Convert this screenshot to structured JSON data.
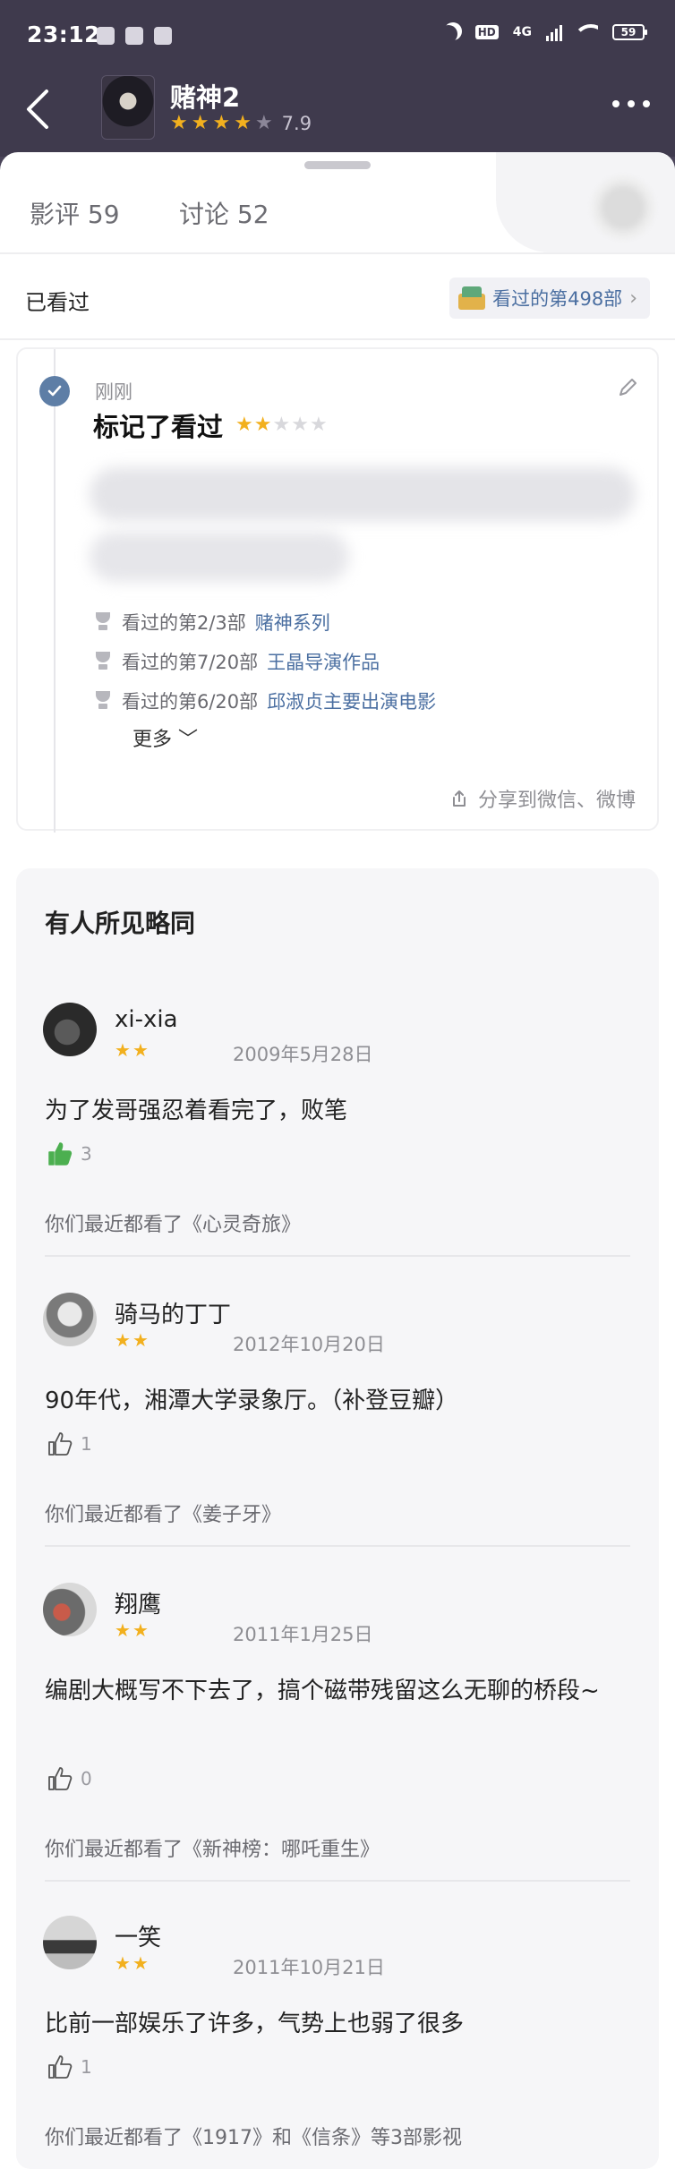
{
  "status_bar": {
    "time": "23:12",
    "network": "4G",
    "battery": "59"
  },
  "header": {
    "title": "赌神2",
    "rating": "7.9",
    "stars_filled": 4
  },
  "tabs": {
    "reviews": "影评 59",
    "discussions": "讨论 52"
  },
  "watched": {
    "label": "已看过",
    "count_text": "看过的第498部"
  },
  "mark": {
    "time": "刚刚",
    "title": "标记了看过",
    "stars_filled": 2,
    "achievements": [
      {
        "text": "看过的第2/3部",
        "link": "赌神系列"
      },
      {
        "text": "看过的第7/20部",
        "link": "王晶导演作品"
      },
      {
        "text": "看过的第6/20部",
        "link": "邱淑贞主要出演电影"
      }
    ],
    "more": "更多",
    "share": "分享到微信、微博"
  },
  "similar": {
    "title": "有人所见略同",
    "reviews": [
      {
        "name": "xi-xia",
        "date": "2009年5月28日",
        "text": "为了发哥强忍着看完了，败笔",
        "likes": "3",
        "liked": true,
        "recent": "你们最近都看了《心灵奇旅》"
      },
      {
        "name": "骑马的丁丁",
        "date": "2012年10月20日",
        "text": "90年代，湘潭大学录象厅。（补登豆瓣）",
        "likes": "1",
        "liked": false,
        "recent": "你们最近都看了《姜子牙》"
      },
      {
        "name": "翔鹰",
        "date": "2011年1月25日",
        "text": "编剧大概写不下去了，搞个磁带残留这么无聊的桥段~",
        "likes": "0",
        "liked": false,
        "recent": "你们最近都看了《新神榜：哪吒重生》"
      },
      {
        "name": "一笑",
        "date": "2011年10月21日",
        "text": "比前一部娱乐了许多，气势上也弱了很多",
        "likes": "1",
        "liked": false,
        "recent": "你们最近都看了《1917》和《信条》等3部影视"
      }
    ]
  },
  "colors": {
    "topbar": "#3f3a4d",
    "link": "#4b6fa1",
    "star": "#f2b01e",
    "like_active": "#4caf50"
  }
}
